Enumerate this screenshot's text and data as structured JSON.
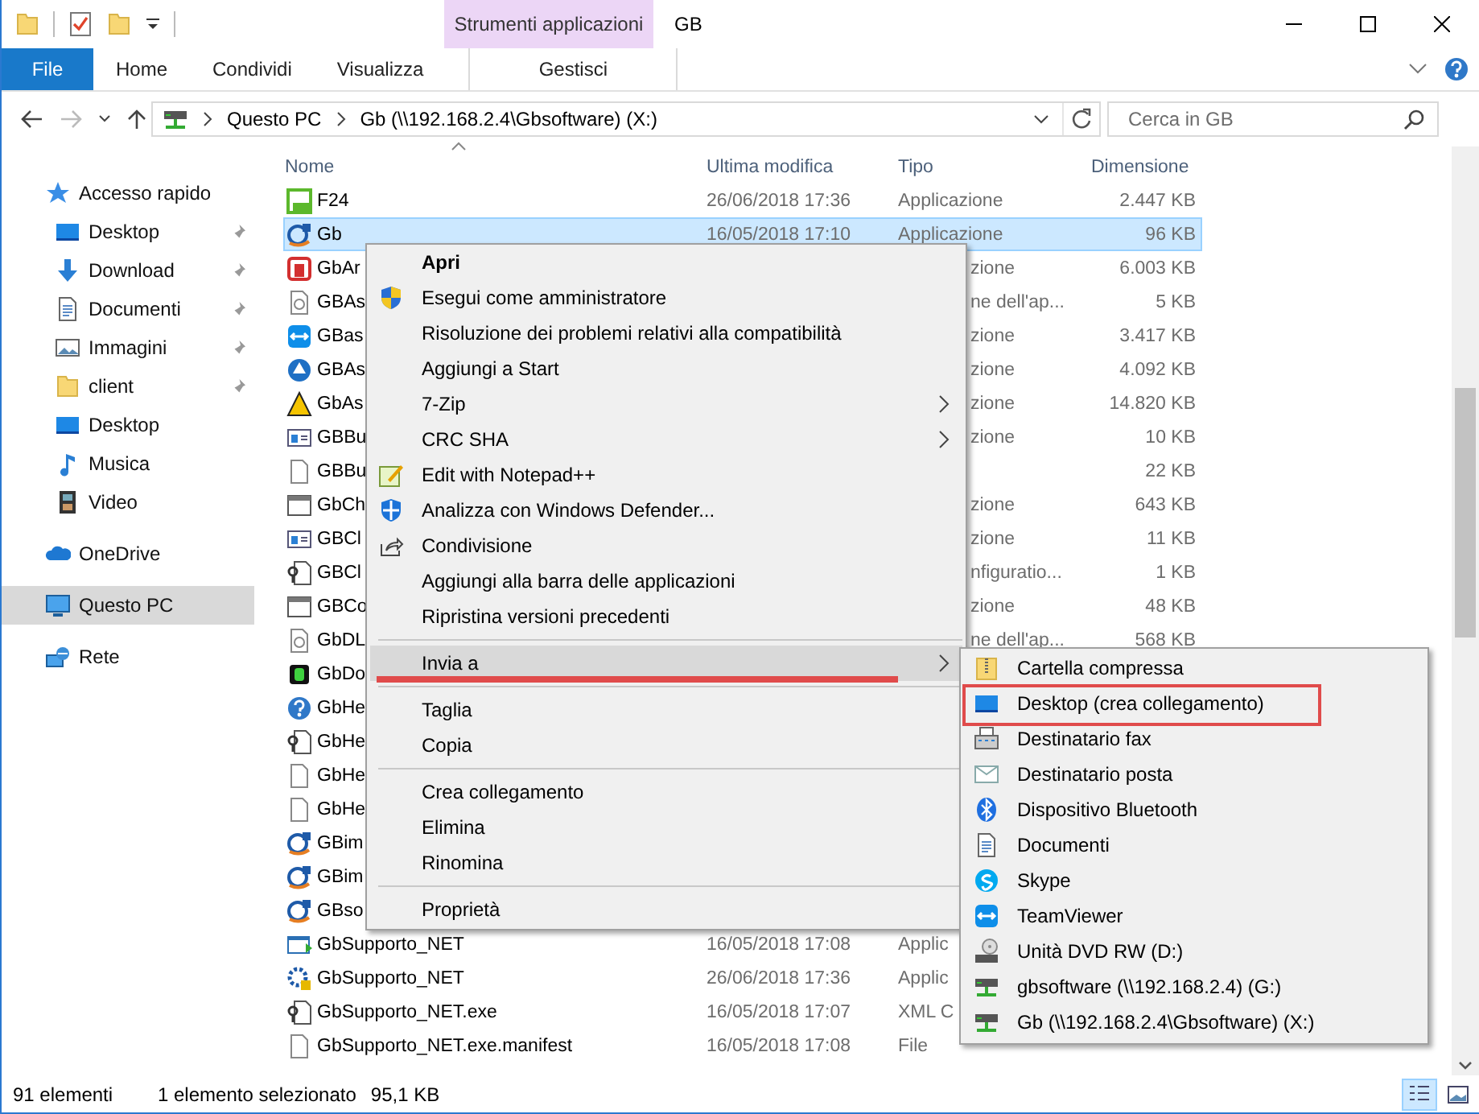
{
  "window": {
    "title": "GB",
    "context_header": "Strumenti applicazioni"
  },
  "ribbon": {
    "tabs": [
      {
        "label": "File",
        "kind": "file",
        "selected": false
      },
      {
        "label": "Home",
        "kind": "tab",
        "selected": false
      },
      {
        "label": "Condividi",
        "kind": "tab",
        "selected": false
      },
      {
        "label": "Visualizza",
        "kind": "tab",
        "selected": false
      },
      {
        "label": "Gestisci",
        "kind": "context",
        "selected": false
      }
    ]
  },
  "address_bar": {
    "segments": [
      "Questo PC",
      "Gb (\\\\192.168.2.4\\Gbsoftware) (X:)"
    ]
  },
  "search": {
    "placeholder": "Cerca in GB"
  },
  "sidebar": {
    "items": [
      {
        "label": "Accesso rapido",
        "kind": "star",
        "selected": false,
        "children": [
          {
            "label": "Desktop",
            "kind": "desktop",
            "pinned": true,
            "selected": false
          },
          {
            "label": "Download",
            "kind": "download",
            "pinned": true,
            "selected": false
          },
          {
            "label": "Documenti",
            "kind": "documents",
            "pinned": true,
            "selected": false
          },
          {
            "label": "Immagini",
            "kind": "pictures",
            "pinned": true,
            "selected": false
          },
          {
            "label": "client",
            "kind": "folder",
            "pinned": true,
            "selected": false
          },
          {
            "label": "Desktop",
            "kind": "desktop",
            "pinned": false,
            "selected": false
          },
          {
            "label": "Musica",
            "kind": "music",
            "pinned": false,
            "selected": false
          },
          {
            "label": "Video",
            "kind": "video",
            "pinned": false,
            "selected": false
          }
        ]
      },
      {
        "label": "OneDrive",
        "kind": "cloud",
        "selected": false
      },
      {
        "label": "Questo PC",
        "kind": "pc",
        "selected": true
      },
      {
        "label": "Rete",
        "kind": "network",
        "selected": false
      }
    ]
  },
  "file_list": {
    "columns": [
      "Nome",
      "Ultima modifica",
      "Tipo",
      "Dimensione"
    ],
    "rows": [
      {
        "name": "F24",
        "modified": "26/06/2018 17:36",
        "type": "Applicazione",
        "size": "2.447 KB",
        "kind": "f24",
        "selected": false
      },
      {
        "name": "Gb",
        "modified": "16/05/2018 17:10",
        "type": "Applicazione",
        "size": "96 KB",
        "kind": "gb",
        "selected": true
      },
      {
        "name": "GbAr",
        "type": "zione",
        "size": "6.003 KB",
        "kind": "red-a",
        "selected": false
      },
      {
        "name": "GBAs",
        "type": "ne dell'ap...",
        "size": "5 KB",
        "kind": "doc",
        "selected": false
      },
      {
        "name": "GBas",
        "type": "zione",
        "size": "3.417 KB",
        "kind": "teamviewer",
        "selected": false
      },
      {
        "name": "GBAs",
        "type": "zione",
        "size": "4.092 KB",
        "kind": "blue-circle",
        "selected": false
      },
      {
        "name": "GbAs",
        "type": "zione",
        "size": "14.820 KB",
        "kind": "yellow-a",
        "selected": false
      },
      {
        "name": "GBBu",
        "type": "zione",
        "size": "10 KB",
        "kind": "list-window",
        "selected": false
      },
      {
        "name": "GBBu",
        "size": "22 KB",
        "kind": "blank",
        "selected": false
      },
      {
        "name": "GbCh",
        "type": "zione",
        "size": "643 KB",
        "kind": "window",
        "selected": false
      },
      {
        "name": "GBCl",
        "type": "zione",
        "size": "11 KB",
        "kind": "list-window",
        "selected": false
      },
      {
        "name": "GBCl",
        "type": "nfiguratio...",
        "size": "1 KB",
        "kind": "config",
        "selected": false
      },
      {
        "name": "GBCo",
        "type": "zione",
        "size": "48 KB",
        "kind": "window",
        "selected": false
      },
      {
        "name": "GbDL",
        "type": "ne dell'ap...",
        "size": "568 KB",
        "kind": "doc",
        "selected": false
      },
      {
        "name": "GbDo",
        "kind": "green-d",
        "selected": false
      },
      {
        "name": "GbHe",
        "kind": "help",
        "selected": false
      },
      {
        "name": "GbHe",
        "kind": "config",
        "selected": false
      },
      {
        "name": "GbHe",
        "kind": "blank",
        "selected": false
      },
      {
        "name": "GbHe",
        "kind": "blank",
        "selected": false
      },
      {
        "name": "GBim",
        "kind": "gb",
        "selected": false
      },
      {
        "name": "GBim",
        "kind": "gb",
        "selected": false
      },
      {
        "name": "GBso",
        "kind": "gb",
        "selected": false
      },
      {
        "name": "GbSupporto_NET",
        "modified": "16/05/2018 17:08",
        "type": "Applic",
        "kind": "run",
        "selected": false
      },
      {
        "name": "GbSupporto_NET",
        "modified": "26/06/2018 17:36",
        "type": "Applic",
        "kind": "gear",
        "selected": false
      },
      {
        "name": "GbSupporto_NET.exe",
        "modified": "16/05/2018 17:07",
        "type": "XML C",
        "kind": "config",
        "selected": false
      },
      {
        "name": "GbSupporto_NET.exe.manifest",
        "modified": "16/05/2018 17:08",
        "type": "File",
        "kind": "blank",
        "selected": false
      }
    ]
  },
  "context_menu": {
    "items": [
      {
        "label": "Apri",
        "kind": "plain",
        "bold": true,
        "submenu": false,
        "selected": false,
        "annotated": false
      },
      {
        "label": "Esegui come amministratore",
        "kind": "shield",
        "bold": false,
        "submenu": false,
        "selected": false,
        "annotated": false
      },
      {
        "label": "Risoluzione dei problemi relativi alla compatibilità",
        "kind": "plain",
        "bold": false,
        "submenu": false,
        "selected": false,
        "annotated": false
      },
      {
        "label": "Aggiungi a Start",
        "kind": "plain",
        "bold": false,
        "submenu": false,
        "selected": false,
        "annotated": false
      },
      {
        "label": "7-Zip",
        "kind": "plain",
        "bold": false,
        "submenu": true,
        "selected": false,
        "annotated": false
      },
      {
        "label": "CRC SHA",
        "kind": "plain",
        "bold": false,
        "submenu": true,
        "selected": false,
        "annotated": false
      },
      {
        "label": "Edit with Notepad++",
        "kind": "notepad",
        "bold": false,
        "submenu": false,
        "selected": false,
        "annotated": false
      },
      {
        "label": "Analizza con Windows Defender...",
        "kind": "defender",
        "bold": false,
        "submenu": false,
        "selected": false,
        "annotated": false
      },
      {
        "label": "Condivisione",
        "kind": "share",
        "bold": false,
        "submenu": false,
        "selected": false,
        "annotated": false
      },
      {
        "label": "Aggiungi alla barra delle applicazioni",
        "kind": "plain",
        "bold": false,
        "submenu": false,
        "selected": false,
        "annotated": false
      },
      {
        "label": "Ripristina versioni precedenti",
        "kind": "plain",
        "bold": false,
        "submenu": false,
        "selected": false,
        "annotated": false
      },
      {
        "kind": "separator"
      },
      {
        "label": "Invia a",
        "kind": "plain",
        "bold": false,
        "submenu": true,
        "selected": true,
        "annotated": true
      },
      {
        "kind": "separator"
      },
      {
        "label": "Taglia",
        "kind": "plain",
        "bold": false,
        "submenu": false,
        "selected": false,
        "annotated": false
      },
      {
        "label": "Copia",
        "kind": "plain",
        "bold": false,
        "submenu": false,
        "selected": false,
        "annotated": false
      },
      {
        "kind": "separator"
      },
      {
        "label": "Crea collegamento",
        "kind": "plain",
        "bold": false,
        "submenu": false,
        "selected": false,
        "annotated": false
      },
      {
        "label": "Elimina",
        "kind": "plain",
        "bold": false,
        "submenu": false,
        "selected": false,
        "annotated": false
      },
      {
        "label": "Rinomina",
        "kind": "plain",
        "bold": false,
        "submenu": false,
        "selected": false,
        "annotated": false
      },
      {
        "kind": "separator"
      },
      {
        "label": "Proprietà",
        "kind": "plain",
        "bold": false,
        "submenu": false,
        "selected": false,
        "annotated": false
      }
    ]
  },
  "send_to_menu": {
    "items": [
      {
        "label": "Cartella compressa",
        "kind": "zip",
        "annotated": false
      },
      {
        "label": "Desktop (crea collegamento)",
        "kind": "desktop",
        "annotated": true
      },
      {
        "label": "Destinatario fax",
        "kind": "fax",
        "annotated": false
      },
      {
        "label": "Destinatario posta",
        "kind": "mail",
        "annotated": false
      },
      {
        "label": "Dispositivo Bluetooth",
        "kind": "bluetooth",
        "annotated": false
      },
      {
        "label": "Documenti",
        "kind": "documents",
        "annotated": false
      },
      {
        "label": "Skype",
        "kind": "skype",
        "annotated": false
      },
      {
        "label": "TeamViewer",
        "kind": "teamviewer",
        "annotated": false
      },
      {
        "label": "Unità DVD RW (D:)",
        "kind": "dvd",
        "annotated": false
      },
      {
        "label": "gbsoftware (\\\\192.168.2.4) (G:)",
        "kind": "netdrive",
        "annotated": false
      },
      {
        "label": "Gb (\\\\192.168.2.4\\Gbsoftware) (X:)",
        "kind": "netdrive",
        "annotated": false
      }
    ]
  },
  "status_bar": {
    "item_count": "91 elementi",
    "selection": "1 elemento selezionato",
    "selection_size": "95,1 KB"
  }
}
